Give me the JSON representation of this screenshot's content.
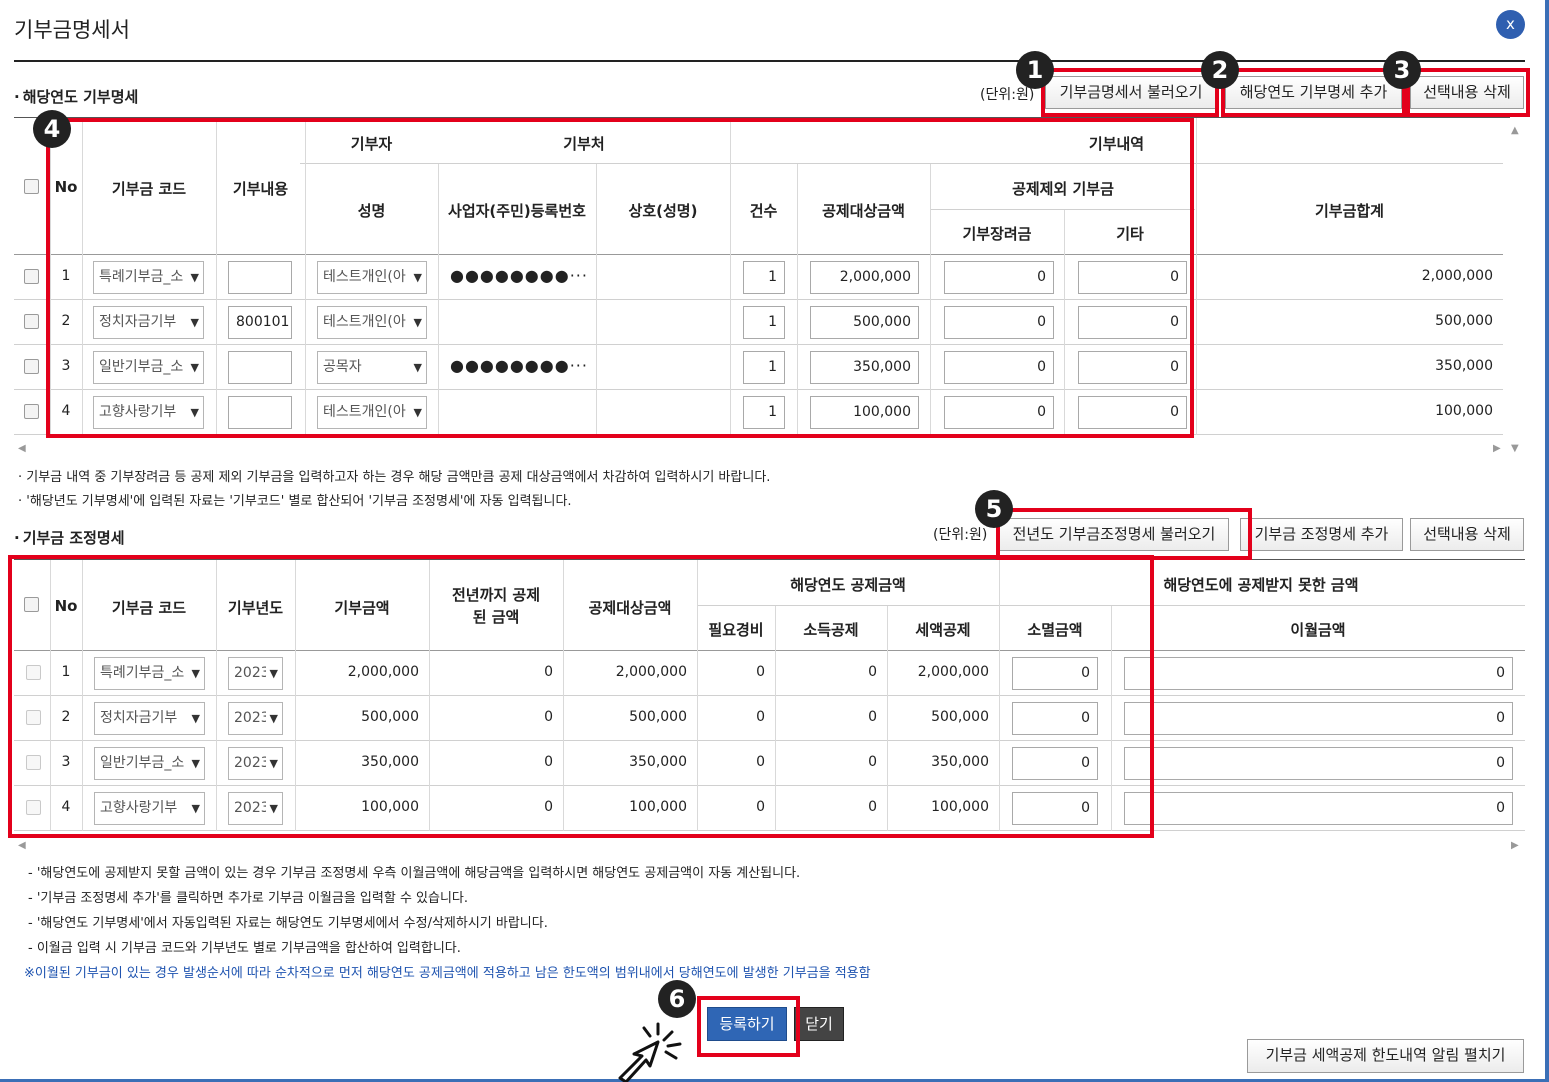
{
  "dialog": {
    "title": "기부금명세서",
    "close_label": "x"
  },
  "donation_section": {
    "title": "해당연도 기부명세",
    "unit": "(단위:원)",
    "buttons": {
      "load": "기부금명세서 불러오기",
      "add": "해당연도 기부명세 추가",
      "delete": "선택내용 삭제"
    },
    "headers": {
      "no": "No",
      "code": "기부금 코드",
      "content": "기부내용",
      "donor": "기부자",
      "donor_name": "성명",
      "recipient": "기부처",
      "reg_no": "사업자(주민)등록번호",
      "company": "상호(성명)",
      "details": "기부내역",
      "count": "건수",
      "deductible": "공제대상금액",
      "excluded": "공제제외 기부금",
      "scholarship": "기부장려금",
      "other": "기타",
      "total": "기부금합계"
    },
    "rows": [
      {
        "no": "1",
        "code": "특례기부금_소",
        "content": "",
        "donor": "테스트개인(아",
        "reg_no": "●●●●●●●●···",
        "company": "",
        "count": "1",
        "deductible": "2,000,000",
        "scholarship": "0",
        "other": "0",
        "total": "2,000,000"
      },
      {
        "no": "2",
        "code": "정치자금기부",
        "content": "800101",
        "donor": "테스트개인(아",
        "reg_no": "",
        "company": "",
        "count": "1",
        "deductible": "500,000",
        "scholarship": "0",
        "other": "0",
        "total": "500,000"
      },
      {
        "no": "3",
        "code": "일반기부금_소",
        "content": "",
        "donor": "공목자",
        "reg_no": "●●●●●●●●···",
        "company": "",
        "count": "1",
        "deductible": "350,000",
        "scholarship": "0",
        "other": "0",
        "total": "350,000"
      },
      {
        "no": "4",
        "code": "고향사랑기부",
        "content": "",
        "donor": "테스트개인(아",
        "reg_no": "",
        "company": "",
        "count": "1",
        "deductible": "100,000",
        "scholarship": "0",
        "other": "0",
        "total": "100,000"
      }
    ],
    "notes": [
      "· 기부금 내역 중 기부장려금 등 공제 제외 기부금을 입력하고자 하는 경우 해당 금액만큼 공제 대상금액에서 차감하여 입력하시기 바랍니다.",
      "· '해당년도 기부명세'에 입력된 자료는 '기부코드' 별로 합산되어 '기부금 조정명세'에 자동 입력됩니다."
    ]
  },
  "adjust_section": {
    "title": "기부금 조정명세",
    "unit": "(단위:원)",
    "buttons": {
      "load_prev": "전년도 기부금조정명세 불러오기",
      "add": "기부금 조정명세 추가",
      "delete": "선택내용 삭제"
    },
    "headers": {
      "no": "No",
      "code": "기부금 코드",
      "year": "기부년도",
      "amount": "기부금액",
      "prev_deducted": "전년까지 공제된 금액",
      "deductible": "공제대상금액",
      "current_deduction": "해당연도 공제금액",
      "expense": "필요경비",
      "income": "소득공제",
      "tax": "세액공제",
      "not_deducted": "해당연도에 공제받지 못한 금액",
      "extinct": "소멸금액",
      "carryover": "이월금액"
    },
    "rows": [
      {
        "no": "1",
        "code": "특례기부금_소",
        "year": "2023",
        "amount": "2,000,000",
        "prev": "0",
        "deductible": "2,000,000",
        "expense": "0",
        "income": "0",
        "tax": "2,000,000",
        "extinct": "0",
        "carryover": "0"
      },
      {
        "no": "2",
        "code": "정치자금기부",
        "year": "2023",
        "amount": "500,000",
        "prev": "0",
        "deductible": "500,000",
        "expense": "0",
        "income": "0",
        "tax": "500,000",
        "extinct": "0",
        "carryover": "0"
      },
      {
        "no": "3",
        "code": "일반기부금_소",
        "year": "2023",
        "amount": "350,000",
        "prev": "0",
        "deductible": "350,000",
        "expense": "0",
        "income": "0",
        "tax": "350,000",
        "extinct": "0",
        "carryover": "0"
      },
      {
        "no": "4",
        "code": "고향사랑기부",
        "year": "2023",
        "amount": "100,000",
        "prev": "0",
        "deductible": "100,000",
        "expense": "0",
        "income": "0",
        "tax": "100,000",
        "extinct": "0",
        "carryover": "0"
      }
    ],
    "notes": [
      "- '해당연도에 공제받지 못할 금액이 있는 경우 기부금 조정명세 우측 이월금액에 해당금액을 입력하시면 해당연도 공제금액이 자동 계산됩니다.",
      "- '기부금 조정명세 추가'를 클릭하면 추가로 기부금 이월금을 입력할 수 있습니다.",
      "- '해당연도 기부명세'에서 자동입력된 자료는 해당연도 기부명세에서 수정/삭제하시기 바랍니다.",
      "- 이월금 입력 시 기부금 코드와 기부년도 별로 기부금액을 합산하여 입력합니다."
    ],
    "note_blue": "※이월된 기부금이 있는 경우 발생순서에 따라 순차적으로 먼저 해당연도 공제금액에 적용하고 남은 한도액의 범위내에서 당해연도에 발생한 기부금을 적용함"
  },
  "footer": {
    "register": "등록하기",
    "close": "닫기",
    "limit_info": "기부금 세액공제 한도내역 알림 펼치기"
  },
  "badges": [
    "1",
    "2",
    "3",
    "4",
    "5",
    "6"
  ],
  "colors": {
    "highlight": "#e3001b",
    "primary": "#2f66b5",
    "frame": "#3b6fb6",
    "note_blue": "#1f54b0"
  },
  "icons": {
    "close": "close-icon",
    "dropdown": "chevron-down-icon",
    "cursor": "click-cursor-icon"
  }
}
